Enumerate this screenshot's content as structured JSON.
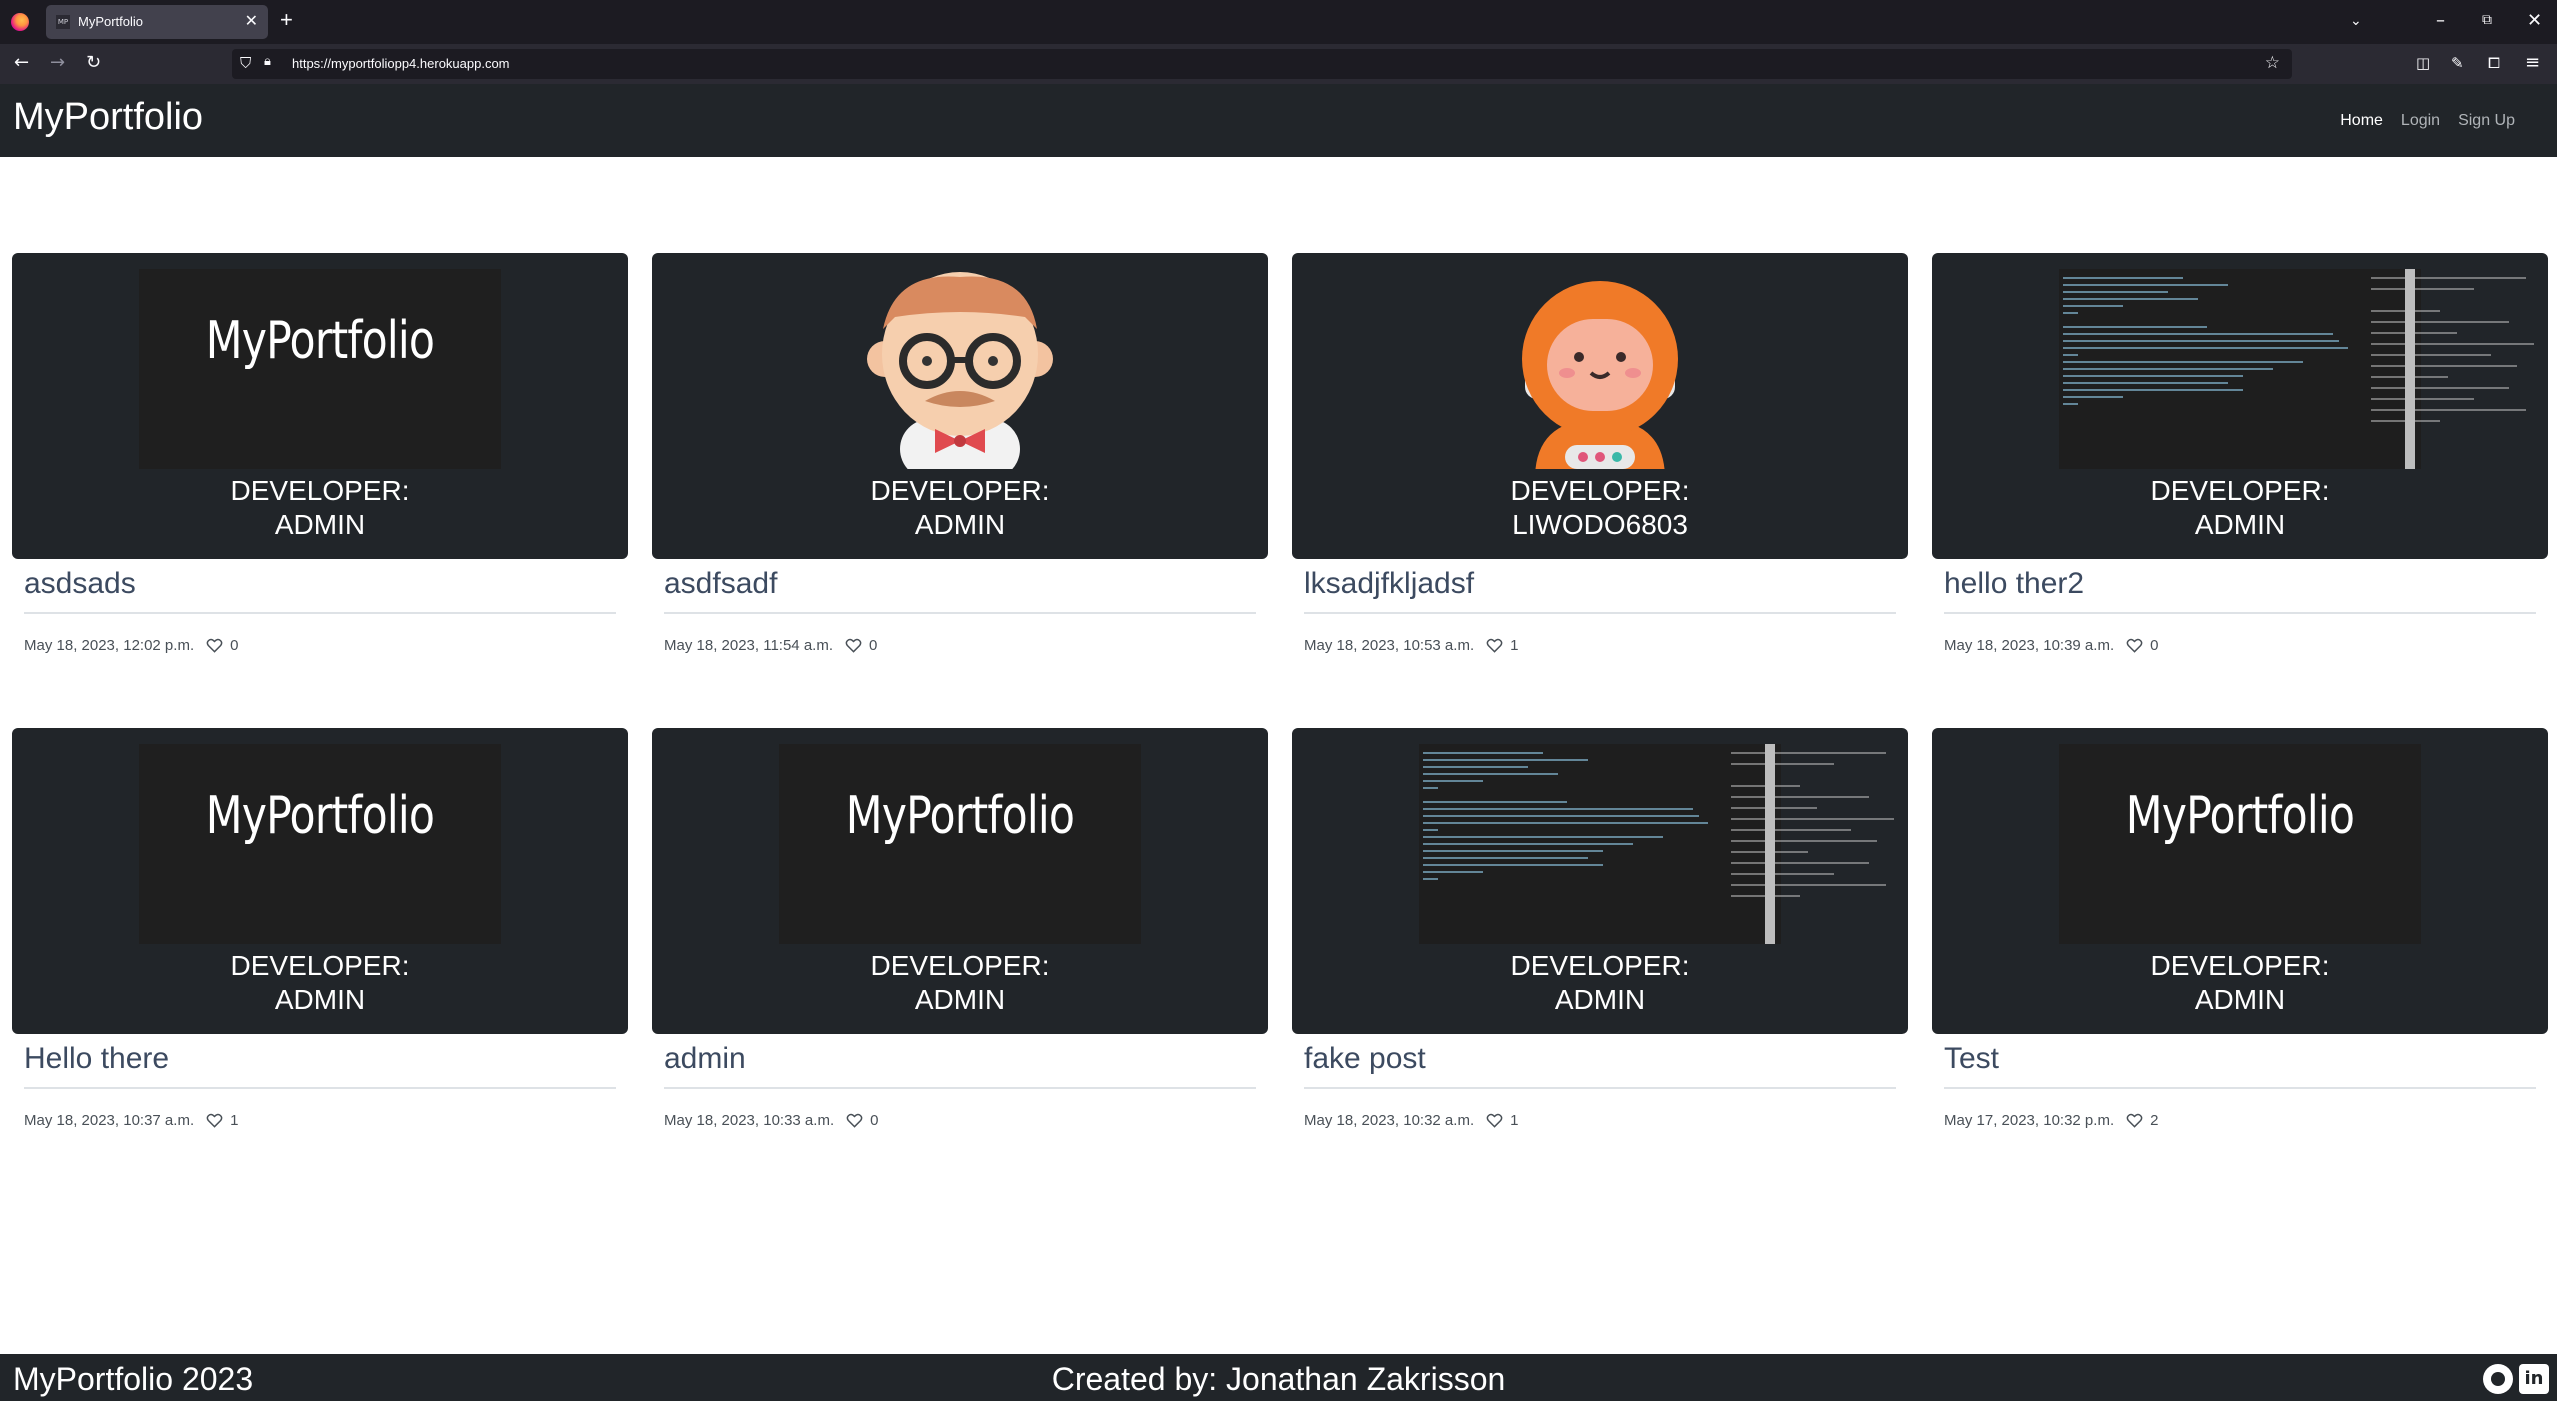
{
  "browser": {
    "tab_title": "MyPortfolio",
    "tab_favicon_text": "MP",
    "url": "https://myportfoliopp4.herokuapp.com",
    "icons": [
      "firefox-logo",
      "back-icon",
      "forward-icon",
      "reload-icon",
      "shield-icon",
      "lock-icon",
      "star-icon",
      "pocket-icon",
      "tools-icon",
      "extensions-icon",
      "menu-icon",
      "list-all-tabs-icon",
      "minimize-icon",
      "restore-icon",
      "close-icon"
    ]
  },
  "site_nav": {
    "brand": "MyPortfolio",
    "links": {
      "home": "Home",
      "login": "Login",
      "signup": "Sign Up"
    }
  },
  "posts": [
    {
      "thumb": "logo",
      "thumb_text": "MyPortfolio",
      "dev_label": "DEVELOPER:",
      "developer": "ADMIN",
      "title": "asdsads",
      "date": "May 18, 2023, 12:02 p.m.",
      "likes": "0"
    },
    {
      "thumb": "avatar-glasses",
      "dev_label": "DEVELOPER:",
      "developer": "ADMIN",
      "title": "asdfsadf",
      "date": "May 18, 2023, 11:54 a.m.",
      "likes": "0"
    },
    {
      "thumb": "avatar-astronaut",
      "dev_label": "DEVELOPER:",
      "developer": "LIWODO6803",
      "title": "lksadjfkljadsf",
      "date": "May 18, 2023, 10:53 a.m.",
      "likes": "1"
    },
    {
      "thumb": "code",
      "dev_label": "DEVELOPER:",
      "developer": "ADMIN",
      "title": "hello ther2",
      "date": "May 18, 2023, 10:39 a.m.",
      "likes": "0"
    },
    {
      "thumb": "logo",
      "thumb_text": "MyPortfolio",
      "dev_label": "DEVELOPER:",
      "developer": "ADMIN",
      "title": "Hello there",
      "date": "May 18, 2023, 10:37 a.m.",
      "likes": "1"
    },
    {
      "thumb": "logo",
      "thumb_text": "MyPortfolio",
      "dev_label": "DEVELOPER:",
      "developer": "ADMIN",
      "title": "admin",
      "date": "May 18, 2023, 10:33 a.m.",
      "likes": "0"
    },
    {
      "thumb": "code",
      "dev_label": "DEVELOPER:",
      "developer": "ADMIN",
      "title": "fake post",
      "date": "May 18, 2023, 10:32 a.m.",
      "likes": "1"
    },
    {
      "thumb": "logo",
      "thumb_text": "MyPortfolio",
      "dev_label": "DEVELOPER:",
      "developer": "ADMIN",
      "title": "Test",
      "date": "May 17, 2023, 10:32 p.m.",
      "likes": "2"
    }
  ],
  "footer": {
    "left": "MyPortfolio 2023",
    "center": "Created by: Jonathan Zakrisson",
    "linkedin_glyph": "in"
  },
  "colors": {
    "card_bg": "#212529",
    "title": "#3c4a60",
    "navbar": "#212529"
  }
}
